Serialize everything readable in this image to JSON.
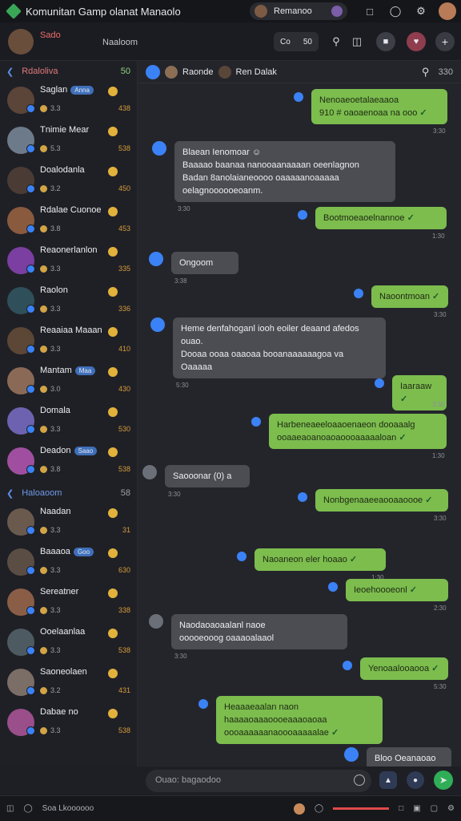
{
  "window": {
    "title": "Komunitan Gamp olanat Manaolo",
    "call_name": "Remanoo"
  },
  "header": {
    "user_name": "Sado",
    "subtitle": "Naaloom",
    "pill_label": "Co",
    "pill_count": "50"
  },
  "sidebar": {
    "section1": {
      "label": "Rdaloliva",
      "count": "50"
    },
    "section2": {
      "label": "Haloaoom",
      "count": "58"
    },
    "chats": [
      {
        "name": "Saglan",
        "tag": "Anna",
        "meta": "3.3",
        "count": "438"
      },
      {
        "name": "Tnimie Mear",
        "tag": "",
        "meta": "5.3",
        "count": "538"
      },
      {
        "name": "Doalodanla",
        "tag": "",
        "meta": "3.2",
        "count": "450"
      },
      {
        "name": "Rdalae Cuonoe",
        "tag": "",
        "meta": "3.8",
        "count": "453"
      },
      {
        "name": "Reaonerlanlon",
        "tag": "",
        "meta": "3.3",
        "count": "335"
      },
      {
        "name": "Raolon",
        "tag": "",
        "meta": "3.3",
        "count": "336"
      },
      {
        "name": "Reaaiaa Maaan",
        "tag": "",
        "meta": "3.3",
        "count": "410"
      },
      {
        "name": "Mantam",
        "tag": "Maa",
        "meta": "3.0",
        "count": "430"
      },
      {
        "name": "Domala",
        "tag": "",
        "meta": "3.3",
        "count": "530"
      },
      {
        "name": "Deadon",
        "tag": "Saao",
        "meta": "3.8",
        "count": "538"
      },
      {
        "name": "Naadan",
        "tag": "",
        "meta": "3.3",
        "count": "31"
      },
      {
        "name": "Baaaoa",
        "tag": "Goo",
        "meta": "3.3",
        "count": "630"
      },
      {
        "name": "Sereatner",
        "tag": "",
        "meta": "3.3",
        "count": "338"
      },
      {
        "name": "Ooelaanlaa",
        "tag": "",
        "meta": "3.3",
        "count": "538"
      },
      {
        "name": "Saoneolaen",
        "tag": "",
        "meta": "3.2",
        "count": "431"
      },
      {
        "name": "Dabae no",
        "tag": "",
        "meta": "3.3",
        "count": "538"
      }
    ]
  },
  "chat": {
    "title": "Raonde",
    "subtitle": "Ren Dalak",
    "count": "330",
    "messages": [
      {
        "dir": "out",
        "text": "Nenoaeoetalaeaaoa\n910 #   oaoaenoaa na ooo",
        "time": "3:30"
      },
      {
        "dir": "in",
        "text": "Blaean Ienomoar  ☺\nBaaaao baanaa nanooaanaaaan oeenlagnon\nBadan 8anolaianeoooo oaaaaanoaaaaa\noelagnoooooeoanm.",
        "time": "3:30"
      },
      {
        "dir": "out",
        "text": "Bootmoeaoelnannoe",
        "time": "1:30"
      },
      {
        "dir": "in",
        "text": "Ongoom",
        "time": "3:38"
      },
      {
        "dir": "out",
        "text": "Naoontmoan",
        "time": "3:30"
      },
      {
        "dir": "in",
        "text": "Heme denfahoganl iooh eoiler deaand afedos\nouao.\nDooaa ooaa oaaoaa booanaaaaaagoa va\nOaaaaa",
        "time": "5:30"
      },
      {
        "dir": "out",
        "text": "Iaaraaw",
        "time": "3:30"
      },
      {
        "dir": "out",
        "text": "Harbeneaeeloaaoenaeon  dooaaalg\nooaaeaoanoaoaoooaaaaaloan",
        "time": "1:30"
      },
      {
        "dir": "in",
        "text": "Saooonar (0) a",
        "time": "3:30"
      },
      {
        "dir": "out",
        "text": "Nonbgenaaeeaooaaoooe",
        "time": "3:30"
      },
      {
        "dir": "out",
        "text": "Naoaneon eler hoaao",
        "time": "1:30"
      },
      {
        "dir": "out",
        "text": "Ieoehoooeonl",
        "time": "2:30"
      },
      {
        "dir": "in",
        "text": "Naodaoaoaalanl naoe\nooooeooog oaaaoalaaol",
        "time": "3:30"
      },
      {
        "dir": "out",
        "text": "Yenoaalooaooa",
        "time": "5:30"
      },
      {
        "dir": "out",
        "text": "Heaaaeaalan naon\nhaaaaoaaaoooeaaaoaoaa\noooaaaaaanaoooaaaaalae",
        "time": "3:30"
      },
      {
        "dir": "in",
        "text": "Bloo Oeanaoao",
        "time": ""
      }
    ]
  },
  "composer": {
    "placeholder": "Ouao: bagaodoo"
  },
  "bottombar": {
    "label": "Soa Lkoooooo"
  },
  "colors": {
    "outgoing": "#7cbd4e",
    "incoming": "#4c4d52",
    "accent": "#3b82f6"
  }
}
